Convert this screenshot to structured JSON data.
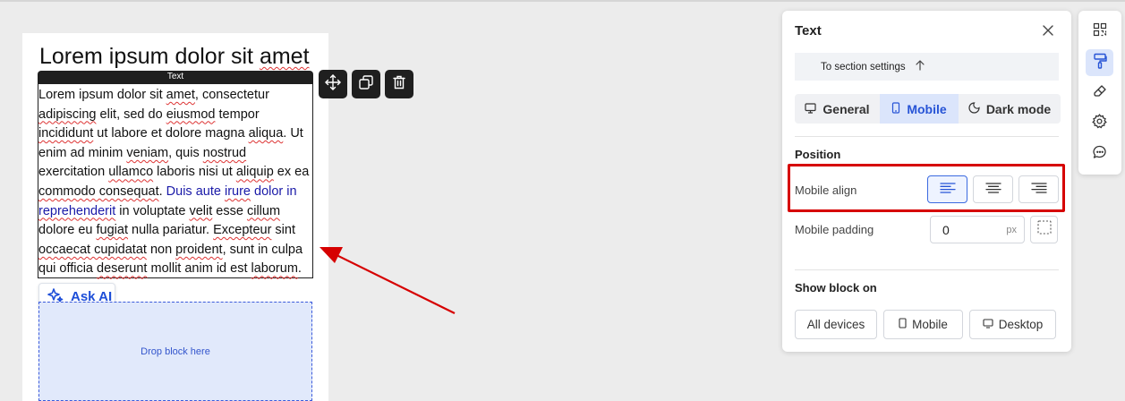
{
  "canvas": {
    "heading_parts": [
      "Lorem ipsum dolor sit ",
      "amet"
    ],
    "block_tag": "Text",
    "body_parts": [
      {
        "t": "Lorem ipsum dolor sit ",
        "s": ""
      },
      {
        "t": "amet",
        "s": "sq"
      },
      {
        "t": ", consectetur ",
        "s": ""
      },
      {
        "t": "adipiscing",
        "s": "sq"
      },
      {
        "t": " elit, sed do ",
        "s": ""
      },
      {
        "t": "eiusmod",
        "s": "sq"
      },
      {
        "t": " tempor ",
        "s": ""
      },
      {
        "t": "incididunt",
        "s": "sq"
      },
      {
        "t": " ut labore et dolore magna ",
        "s": ""
      },
      {
        "t": "aliqua",
        "s": "sq"
      },
      {
        "t": ". Ut enim ad minim ",
        "s": ""
      },
      {
        "t": "veniam",
        "s": "sq"
      },
      {
        "t": ", quis ",
        "s": ""
      },
      {
        "t": "nostrud",
        "s": "sq"
      },
      {
        "t": " exercitation ",
        "s": ""
      },
      {
        "t": "ullamco",
        "s": "sq"
      },
      {
        "t": " laboris nisi ut ",
        "s": ""
      },
      {
        "t": "aliquip",
        "s": "sq"
      },
      {
        "t": " ex ea ",
        "s": ""
      },
      {
        "t": "commodo consequat",
        "s": "sq"
      },
      {
        "t": ". ",
        "s": ""
      },
      {
        "t": "Duis aute ",
        "s": "link"
      },
      {
        "t": "irure",
        "s": "link sq"
      },
      {
        "t": " dolor in ",
        "s": "link"
      },
      {
        "t": "reprehenderit",
        "s": "link sq"
      },
      {
        "t": " in voluptate ",
        "s": ""
      },
      {
        "t": "velit",
        "s": "sq"
      },
      {
        "t": " esse ",
        "s": ""
      },
      {
        "t": "cillum",
        "s": "sq"
      },
      {
        "t": " dolore eu ",
        "s": ""
      },
      {
        "t": "fugiat",
        "s": "sq"
      },
      {
        "t": " nulla pariatur. ",
        "s": ""
      },
      {
        "t": "Excepteur",
        "s": "sq"
      },
      {
        "t": " sint ",
        "s": ""
      },
      {
        "t": "occaecat cupidatat",
        "s": "sq"
      },
      {
        "t": " non ",
        "s": ""
      },
      {
        "t": "proident",
        "s": "sq"
      },
      {
        "t": ", sunt in culpa qui officia ",
        "s": ""
      },
      {
        "t": "deserunt",
        "s": "sq"
      },
      {
        "t": " mollit anim id est ",
        "s": ""
      },
      {
        "t": "laborum",
        "s": "sq"
      },
      {
        "t": ".",
        "s": ""
      }
    ],
    "ask_ai_label": "Ask AI",
    "drop_zone_label": "Drop block here",
    "float_tools": [
      "move-icon",
      "duplicate-icon",
      "trash-icon"
    ]
  },
  "panel": {
    "title": "Text",
    "section_link": "To section settings",
    "tabs": [
      {
        "label": "General",
        "icon": "monitor-icon",
        "active": false
      },
      {
        "label": "Mobile",
        "icon": "phone-icon",
        "active": true
      },
      {
        "label": "Dark mode",
        "icon": "moon-icon",
        "active": false
      }
    ],
    "position_heading": "Position",
    "mobile_align_label": "Mobile align",
    "align_options": [
      "align-left-icon",
      "align-center-icon",
      "align-right-icon"
    ],
    "align_selected": "align-left-icon",
    "mobile_padding_label": "Mobile padding",
    "mobile_padding_value": "0",
    "padding_unit": "px",
    "show_block_heading": "Show block on",
    "show_block_options": [
      {
        "label": "All devices",
        "icon": ""
      },
      {
        "label": "Mobile",
        "icon": "phone-icon"
      },
      {
        "label": "Desktop",
        "icon": "monitor-icon"
      }
    ]
  },
  "rail": [
    "qr-code-icon",
    "paint-roller-icon",
    "eraser-icon",
    "gear-icon",
    "chat-icon"
  ],
  "rail_active": "paint-roller-icon",
  "colors": {
    "accent": "#2754d6",
    "annotation": "#d60000",
    "drop_zone": "#e1e9fb",
    "toolbar": "#1f1f1f"
  }
}
